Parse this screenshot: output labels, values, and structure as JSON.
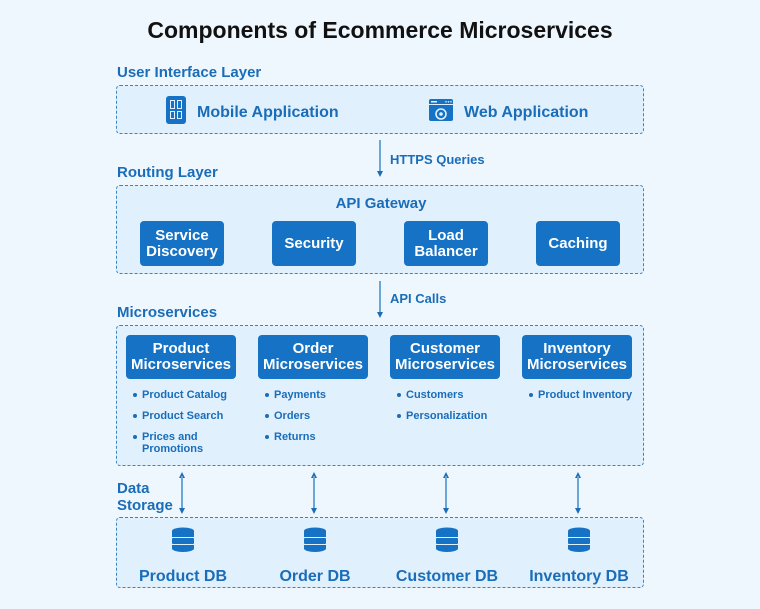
{
  "title": "Components of Ecommerce Microservices",
  "colors": {
    "primary": "#1672c4",
    "panel_fill": "#e1f0fd",
    "background": "#eff7fe",
    "dashed_border": "#3a84c6"
  },
  "ui_layer": {
    "label": "User Interface Layer",
    "items": [
      {
        "label": "Mobile Application",
        "icon": "mobile-app-icon"
      },
      {
        "label": "Web Application",
        "icon": "web-app-icon"
      }
    ]
  },
  "edges": {
    "https": "HTTPS Queries",
    "api_calls": "API Calls"
  },
  "routing_layer": {
    "label": "Routing Layer",
    "gateway": "API Gateway",
    "components": [
      "Service\nDiscovery",
      "Security",
      "Load\nBalancer",
      "Caching"
    ]
  },
  "microservices": {
    "label": "Microservices",
    "services": [
      {
        "name_line1": "Product",
        "name_line2": "Microservices",
        "features": [
          "Product Catalog",
          "Product Search",
          "Prices and Promotions"
        ]
      },
      {
        "name_line1": "Order",
        "name_line2": "Microservices",
        "features": [
          "Payments",
          "Orders",
          "Returns"
        ]
      },
      {
        "name_line1": "Customer",
        "name_line2": "Microservices",
        "features": [
          "Customers",
          "Personalization"
        ]
      },
      {
        "name_line1": "Inventory",
        "name_line2": "Microservices",
        "features": [
          "Product Inventory"
        ]
      }
    ]
  },
  "data_storage": {
    "label_line1": "Data",
    "label_line2": "Storage",
    "databases": [
      "Product DB",
      "Order DB",
      "Customer DB",
      "Inventory DB"
    ]
  }
}
